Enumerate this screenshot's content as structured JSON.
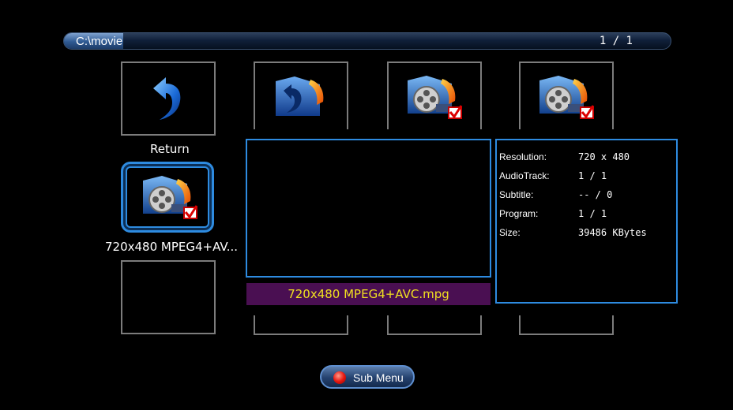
{
  "header": {
    "path": "C:\\movie",
    "page_count": "1 / 1"
  },
  "grid": {
    "return_label": "Return",
    "selected_label": "720x480 MPEG4+AV..."
  },
  "preview": {
    "filename": "720x480 MPEG4+AVC.mpg"
  },
  "info": {
    "resolution_label": "Resolution:",
    "resolution_value": "720 x 480",
    "audio_label": "AudioTrack:",
    "audio_value": "1 / 1",
    "subtitle_label": "Subtitle:",
    "subtitle_value": "-- / 0",
    "program_label": "Program:",
    "program_value": "1 / 1",
    "size_label": "Size:",
    "size_value": "39486 KBytes"
  },
  "footer": {
    "submenu_label": "Sub Menu"
  },
  "icons": [
    "return-icon",
    "parent-folder-icon",
    "movie-file-icon",
    "checkbox-icon"
  ],
  "colors": {
    "accent": "#2e8be0",
    "filename_bg": "#4a0f52",
    "filename_text": "#f0e020"
  }
}
